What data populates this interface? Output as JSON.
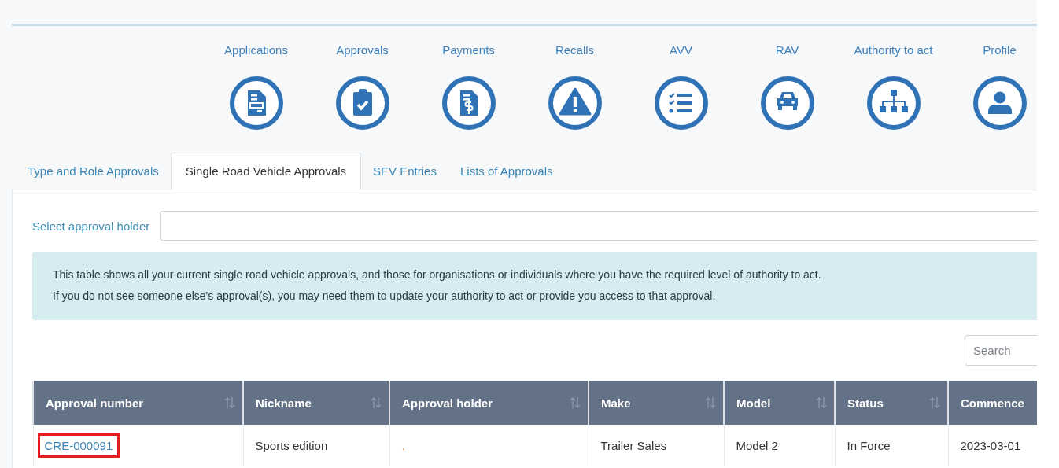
{
  "nav": [
    {
      "label": "Applications"
    },
    {
      "label": "Approvals"
    },
    {
      "label": "Payments"
    },
    {
      "label": "Recalls"
    },
    {
      "label": "AVV"
    },
    {
      "label": "RAV"
    },
    {
      "label": "Authority to act"
    },
    {
      "label": "Profile"
    }
  ],
  "tabs": [
    {
      "label": "Type and Role Approvals",
      "selected": false
    },
    {
      "label": "Single Road Vehicle Approvals",
      "selected": true
    },
    {
      "label": "SEV Entries",
      "selected": false
    },
    {
      "label": "Lists of Approvals",
      "selected": false
    }
  ],
  "filter": {
    "label": "Select approval holder"
  },
  "notice": [
    "This table shows all your current single road vehicle approvals, and those for organisations or individuals where you have the required level of authority to act.",
    "If you do not see someone else's approval(s), you may need them to update your authority to act or provide you access to that approval."
  ],
  "search": {
    "placeholder": "Search"
  },
  "table": {
    "columns": [
      {
        "label": "Approval number",
        "sortable": true
      },
      {
        "label": "Nickname",
        "sortable": true
      },
      {
        "label": "Approval holder",
        "sortable": true
      },
      {
        "label": "Make",
        "sortable": true
      },
      {
        "label": "Model",
        "sortable": true
      },
      {
        "label": "Status",
        "sortable": true
      },
      {
        "label": "Commence",
        "sortable": false
      }
    ],
    "rows": [
      {
        "cells": [
          {
            "text": "CRE-000091",
            "kind": "link",
            "highlighted": true
          },
          {
            "text": "Sports edition",
            "kind": "text"
          },
          {
            "text": ".",
            "kind": "mark"
          },
          {
            "text": "Trailer Sales",
            "kind": "text"
          },
          {
            "text": "Model 2",
            "kind": "text"
          },
          {
            "text": "In Force",
            "kind": "text"
          },
          {
            "text": "2023-03-01",
            "kind": "text"
          }
        ]
      }
    ]
  }
}
